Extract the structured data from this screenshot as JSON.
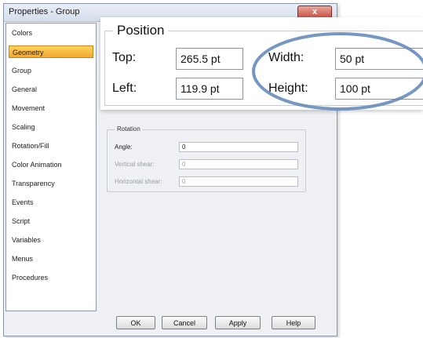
{
  "dialog": {
    "title": "Properties - Group",
    "close_label": "x"
  },
  "sidebar": {
    "items": [
      {
        "label": "Colors",
        "active": false
      },
      {
        "label": "Geometry",
        "active": true
      },
      {
        "label": "Group",
        "active": false
      },
      {
        "label": "General",
        "active": false
      },
      {
        "label": "Movement",
        "active": false
      },
      {
        "label": "Scaling",
        "active": false
      },
      {
        "label": "Rotation/Fill",
        "active": false
      },
      {
        "label": "Color Animation",
        "active": false
      },
      {
        "label": "Transparency",
        "active": false
      },
      {
        "label": "Events",
        "active": false
      },
      {
        "label": "Script",
        "active": false
      },
      {
        "label": "Variables",
        "active": false
      },
      {
        "label": "Menus",
        "active": false
      },
      {
        "label": "Procedures",
        "active": false
      }
    ]
  },
  "position": {
    "title": "Position",
    "top_label": "Top:",
    "top_value": "265.5 pt",
    "left_label": "Left:",
    "left_value": "119.9 pt",
    "width_label": "Width:",
    "width_value": "50 pt",
    "height_label": "Height:",
    "height_value": "100 pt"
  },
  "rotation": {
    "title": "Rotation",
    "angle_label": "Angle:",
    "angle_value": "0",
    "vshear_label": "Vertical shear:",
    "vshear_value": "0",
    "hshear_label": "Horizontal shear:",
    "hshear_value": "0"
  },
  "buttons": {
    "ok": "OK",
    "cancel": "Cancel",
    "apply": "Apply",
    "help": "Help"
  },
  "colors": {
    "highlight_oval": "#5f85b8",
    "active_nav": "#f0a833",
    "close_button": "#c9463a"
  }
}
